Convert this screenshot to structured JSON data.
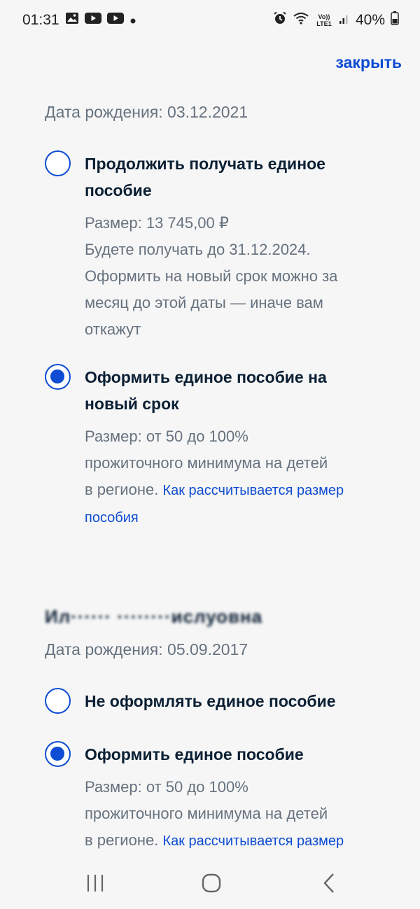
{
  "status_bar": {
    "time": "01:31",
    "battery": "40%",
    "lte": "Vo)) LTE1"
  },
  "header": {
    "close_label": "закрыть"
  },
  "child1": {
    "dob": "Дата рождения: 03.12.2021",
    "options": [
      {
        "title_line1": "Продолжить получать единое",
        "title_line2": "пособие",
        "checked": false,
        "desc": [
          "Размер: 13 745,00 ₽",
          "Будете получать до 31.12.2024.",
          "Оформить на новый срок можно за",
          "месяц до этой даты — иначе вам",
          "откажут"
        ]
      },
      {
        "title_line1": "Оформить единое пособие на",
        "title_line2": "новый срок",
        "checked": true,
        "desc": [
          "Размер: от 50 до 100%",
          "прожиточного минимума на детей",
          "в регионе."
        ],
        "link_part1": "Как рассчитывается размер",
        "link_part2": "пособия"
      }
    ]
  },
  "child2": {
    "name": "Ил······ ········ислуовна",
    "dob": "Дата рождения: 05.09.2017",
    "options": [
      {
        "title": "Не оформлять единое пособие",
        "checked": false
      },
      {
        "title": "Оформить единое пособие",
        "checked": true,
        "desc": [
          "Размер: от 50 до 100%",
          "прожиточного минимума на детей",
          "в регионе."
        ],
        "link_part1": "Как рассчитывается размер"
      }
    ]
  },
  "icons": [
    "image-icon",
    "youtube-icon",
    "alarm-icon",
    "wifi-icon",
    "signal-icon",
    "battery-icon",
    "recents-icon",
    "home-icon",
    "back-icon"
  ]
}
